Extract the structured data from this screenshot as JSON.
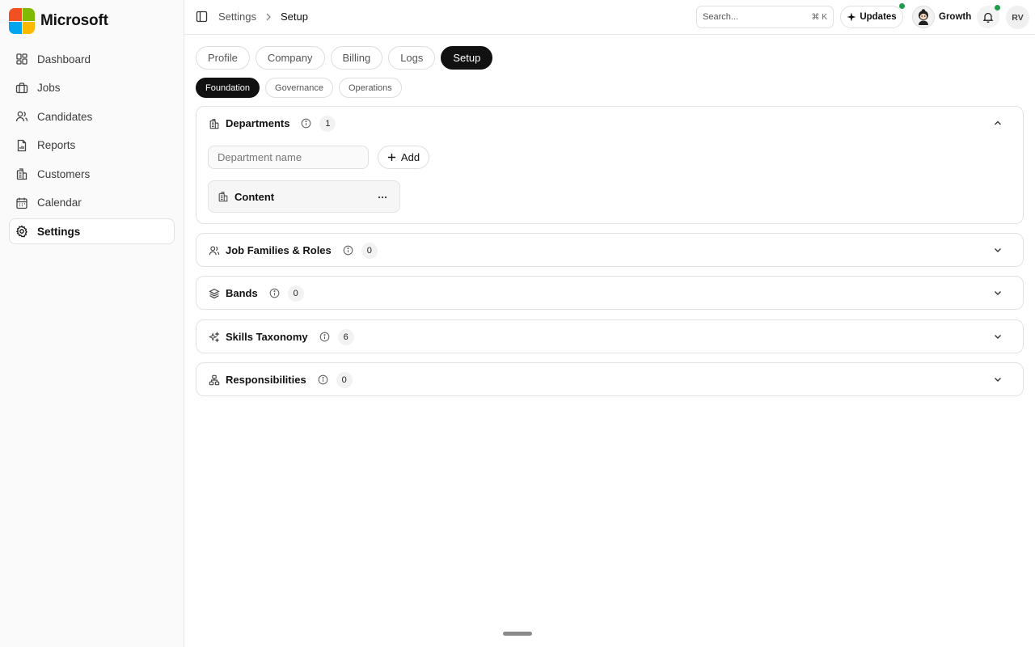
{
  "brand": {
    "name": "Microsoft",
    "logo_colors": [
      "#f25022",
      "#7fba00",
      "#00a4ef",
      "#ffb900"
    ]
  },
  "sidebar": {
    "items": [
      {
        "label": "Dashboard",
        "icon": "dashboard-icon",
        "active": false
      },
      {
        "label": "Jobs",
        "icon": "briefcase-icon",
        "active": false
      },
      {
        "label": "Candidates",
        "icon": "users-icon",
        "active": false
      },
      {
        "label": "Reports",
        "icon": "report-icon",
        "active": false
      },
      {
        "label": "Customers",
        "icon": "building-icon",
        "active": false
      },
      {
        "label": "Calendar",
        "icon": "calendar-icon",
        "active": false
      },
      {
        "label": "Settings",
        "icon": "gear-icon",
        "active": true
      }
    ]
  },
  "topbar": {
    "breadcrumb": [
      "Settings",
      "Setup"
    ],
    "search": {
      "placeholder": "Search...",
      "shortcut": "⌘ K"
    },
    "updates_label": "Updates",
    "workspace_label": "Growth",
    "user_initials": "RV",
    "status_color": "#1f9d4d"
  },
  "tabs": [
    {
      "label": "Profile",
      "active": false
    },
    {
      "label": "Company",
      "active": false
    },
    {
      "label": "Billing",
      "active": false
    },
    {
      "label": "Logs",
      "active": false
    },
    {
      "label": "Setup",
      "active": true
    }
  ],
  "subtabs": [
    {
      "label": "Foundation",
      "active": true
    },
    {
      "label": "Governance",
      "active": false
    },
    {
      "label": "Operations",
      "active": false
    }
  ],
  "sections": [
    {
      "title": "Departments",
      "count": "1",
      "icon": "building-icon",
      "expanded": true
    },
    {
      "title": "Job Families & Roles",
      "count": "0",
      "icon": "users-icon",
      "expanded": false
    },
    {
      "title": "Bands",
      "count": "0",
      "icon": "layers-icon",
      "expanded": false
    },
    {
      "title": "Skills Taxonomy",
      "count": "6",
      "icon": "sparkles-icon",
      "expanded": false
    },
    {
      "title": "Responsibilities",
      "count": "0",
      "icon": "hierarchy-icon",
      "expanded": false
    }
  ],
  "departments": {
    "input_placeholder": "Department name",
    "add_label": "Add",
    "items": [
      {
        "name": "Content"
      }
    ]
  }
}
